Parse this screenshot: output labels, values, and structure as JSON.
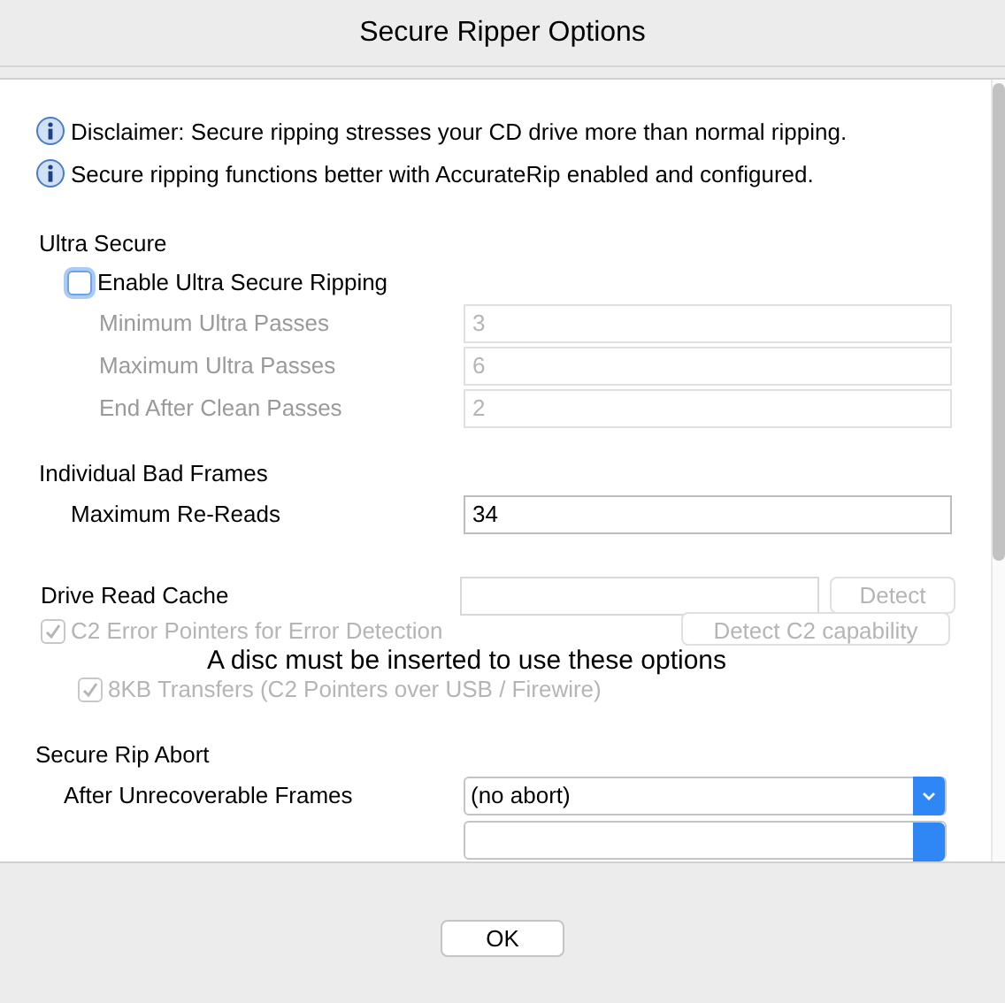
{
  "window": {
    "title": "Secure Ripper Options"
  },
  "info_messages": [
    "Disclaimer: Secure ripping stresses your CD drive more than normal ripping.",
    "Secure ripping functions better with AccurateRip enabled and configured."
  ],
  "ultra_secure": {
    "title": "Ultra Secure",
    "enable": {
      "label": "Enable Ultra Secure Ripping",
      "checked": false
    },
    "fields": [
      {
        "label": "Minimum Ultra Passes",
        "value": "3",
        "disabled": true
      },
      {
        "label": "Maximum Ultra Passes",
        "value": "6",
        "disabled": true
      },
      {
        "label": "End After Clean Passes",
        "value": "2",
        "disabled": true
      }
    ]
  },
  "bad_frames": {
    "title": "Individual Bad Frames",
    "fields": [
      {
        "label": "Maximum Re-Reads",
        "value": "34",
        "disabled": false
      }
    ]
  },
  "drive_read_cache": {
    "title": "Drive Read Cache",
    "detect_button": {
      "label": "Detect",
      "disabled": true
    },
    "options": [
      {
        "label": "C2 Error Pointers for Error Detection",
        "checked": true,
        "disabled": true,
        "children": [
          {
            "label": "8KB Transfers (C2 Pointers over USB / Firewire)",
            "checked": true,
            "disabled": true
          }
        ]
      }
    ],
    "detect_c2_button": {
      "label": "Detect C2 capability",
      "disabled": true
    },
    "overlay_message": "A disc must be inserted to use these options"
  },
  "secure_rip_abort": {
    "title": "Secure Rip Abort",
    "selects": [
      {
        "label": "After Unrecoverable Frames",
        "value": "(no abort)"
      }
    ]
  },
  "buttons": [
    {
      "label": "OK"
    }
  ]
}
